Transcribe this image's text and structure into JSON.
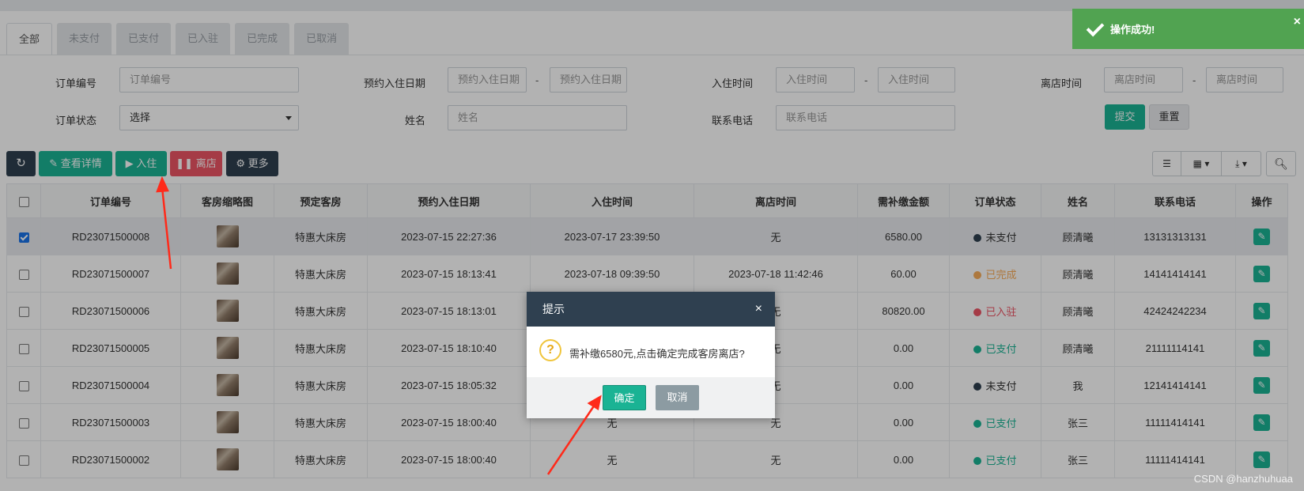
{
  "tabs": [
    "全部",
    "未支付",
    "已支付",
    "已入驻",
    "已完成",
    "已取消"
  ],
  "filters": {
    "order_no_label": "订单编号",
    "order_no_placeholder": "订单编号",
    "reserve_date_label": "预约入住日期",
    "reserve_from_placeholder": "预约入住日期",
    "reserve_to_placeholder": "预约入住日期",
    "checkin_label": "入住时间",
    "checkin_from_placeholder": "入住时间",
    "checkin_to_placeholder": "入住时间",
    "checkout_label": "离店时间",
    "checkout_from_placeholder": "离店时间",
    "checkout_to_placeholder": "离店时间",
    "status_label": "订单状态",
    "status_value": "选择",
    "name_label": "姓名",
    "name_placeholder": "姓名",
    "phone_label": "联系电话",
    "phone_placeholder": "联系电话",
    "dash": "-",
    "submit_label": "提交",
    "reset_label": "重置"
  },
  "toolbar": {
    "detail_label": "查看详情",
    "checkin_label": "入住",
    "checkout_label": "离店",
    "more_label": "更多"
  },
  "table": {
    "headers": [
      "订单编号",
      "客房缩略图",
      "预定客房",
      "预约入住日期",
      "入住时间",
      "离店时间",
      "需补缴金额",
      "订单状态",
      "姓名",
      "联系电话",
      "操作"
    ],
    "rows": [
      {
        "selected": true,
        "order_no": "RD23071500008",
        "room": "特惠大床房",
        "reserve": "2023-07-15 22:27:36",
        "checkin": "2023-07-17 23:39:50",
        "checkout": "无",
        "amount": "6580.00",
        "status": "未支付",
        "status_color": "#2f4050",
        "name": "顾清曦",
        "phone": "13131313131"
      },
      {
        "selected": false,
        "order_no": "RD23071500007",
        "room": "特惠大床房",
        "reserve": "2023-07-15 18:13:41",
        "checkin": "2023-07-18 09:39:50",
        "checkout": "2023-07-18 11:42:46",
        "amount": "60.00",
        "status": "已完成",
        "status_color": "#f8ac59",
        "name": "顾清曦",
        "phone": "14141414141"
      },
      {
        "selected": false,
        "order_no": "RD23071500006",
        "room": "特惠大床房",
        "reserve": "2023-07-15 18:13:01",
        "checkin": "",
        "checkout": "无",
        "amount": "80820.00",
        "status": "已入驻",
        "status_color": "#ed5565",
        "name": "顾清曦",
        "phone": "42424242234"
      },
      {
        "selected": false,
        "order_no": "RD23071500005",
        "room": "特惠大床房",
        "reserve": "2023-07-15 18:10:40",
        "checkin": "",
        "checkout": "无",
        "amount": "0.00",
        "status": "已支付",
        "status_color": "#1ab394",
        "name": "顾清曦",
        "phone": "21111114141"
      },
      {
        "selected": false,
        "order_no": "RD23071500004",
        "room": "特惠大床房",
        "reserve": "2023-07-15 18:05:32",
        "checkin": "",
        "checkout": "无",
        "amount": "0.00",
        "status": "未支付",
        "status_color": "#2f4050",
        "name": "我",
        "phone": "12141414141"
      },
      {
        "selected": false,
        "order_no": "RD23071500003",
        "room": "特惠大床房",
        "reserve": "2023-07-15 18:00:40",
        "checkin": "无",
        "checkout": "无",
        "amount": "0.00",
        "status": "已支付",
        "status_color": "#1ab394",
        "name": "张三",
        "phone": "11111414141"
      },
      {
        "selected": false,
        "order_no": "RD23071500002",
        "room": "特惠大床房",
        "reserve": "2023-07-15 18:00:40",
        "checkin": "无",
        "checkout": "无",
        "amount": "0.00",
        "status": "已支付",
        "status_color": "#1ab394",
        "name": "张三",
        "phone": "11111414141"
      }
    ]
  },
  "dialog": {
    "title": "提示",
    "message": "需补缴6580元,点击确定完成客房离店?",
    "confirm_label": "确定",
    "cancel_label": "取消"
  },
  "toast": {
    "message": "操作成功!"
  },
  "watermark": "CSDN @hanzhuhuaa",
  "colors": {
    "accent": "#1ab394",
    "dark": "#2f4050",
    "danger": "#ed5565",
    "toast": "#51a351",
    "arrow": "#ff2a1a"
  }
}
